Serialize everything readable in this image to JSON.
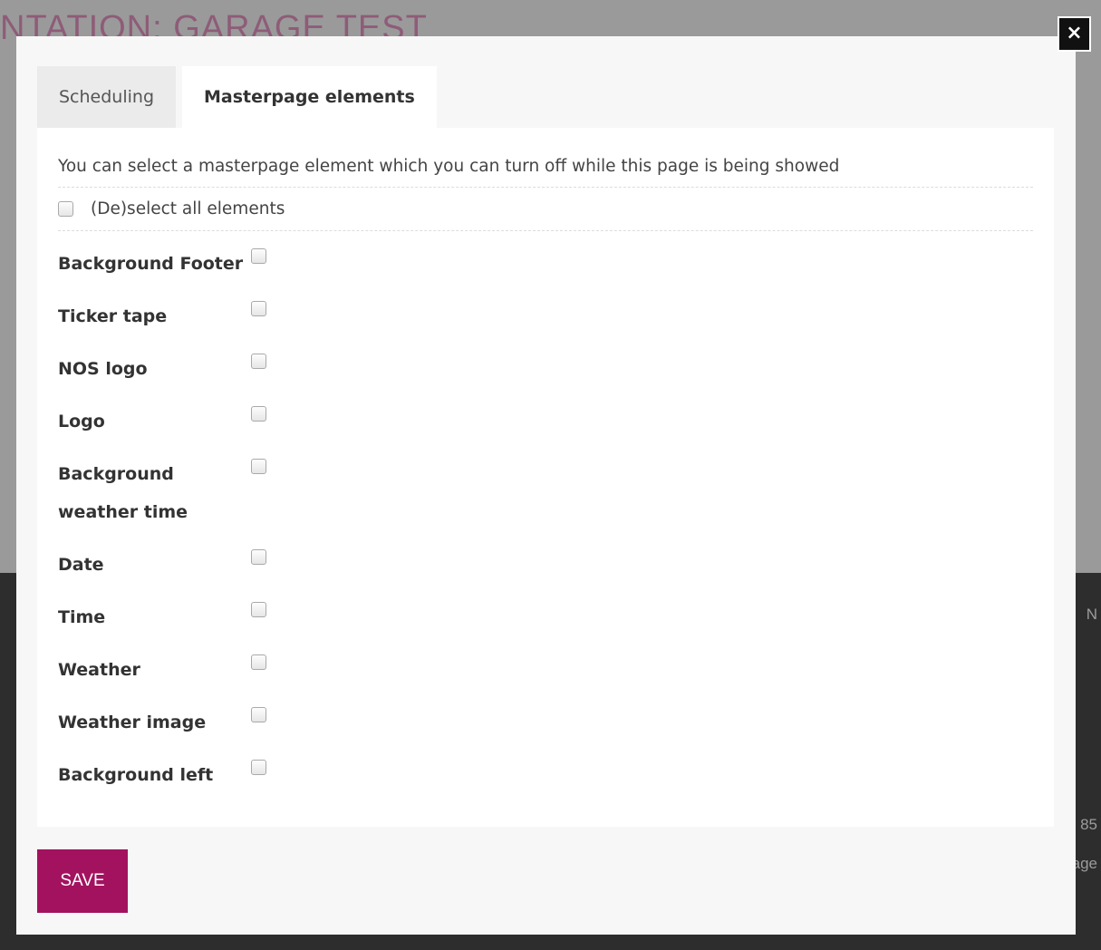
{
  "background": {
    "title": "NTATION: GARAGE TEST",
    "right_snippets": [
      "N",
      "85",
      "age"
    ]
  },
  "modal": {
    "close_icon": "×",
    "tabs": [
      {
        "label": "Scheduling",
        "active": false
      },
      {
        "label": "Masterpage elements",
        "active": true
      }
    ],
    "intro": "You can select a masterpage element which you can turn off while this page is being showed",
    "select_all_label": "(De)select all elements",
    "elements": [
      {
        "label": "Background Footer",
        "checked": false
      },
      {
        "label": "Ticker tape",
        "checked": false
      },
      {
        "label": "NOS logo",
        "checked": false
      },
      {
        "label": "Logo",
        "checked": false
      },
      {
        "label": "Background weather time",
        "checked": false
      },
      {
        "label": "Date",
        "checked": false
      },
      {
        "label": "Time",
        "checked": false
      },
      {
        "label": "Weather",
        "checked": false
      },
      {
        "label": "Weather image",
        "checked": false
      },
      {
        "label": "Background left",
        "checked": false
      }
    ],
    "save_label": "SAVE",
    "colors": {
      "accent": "#a3125f",
      "overlay": "#9a9a9a",
      "panel": "#ffffff"
    }
  }
}
